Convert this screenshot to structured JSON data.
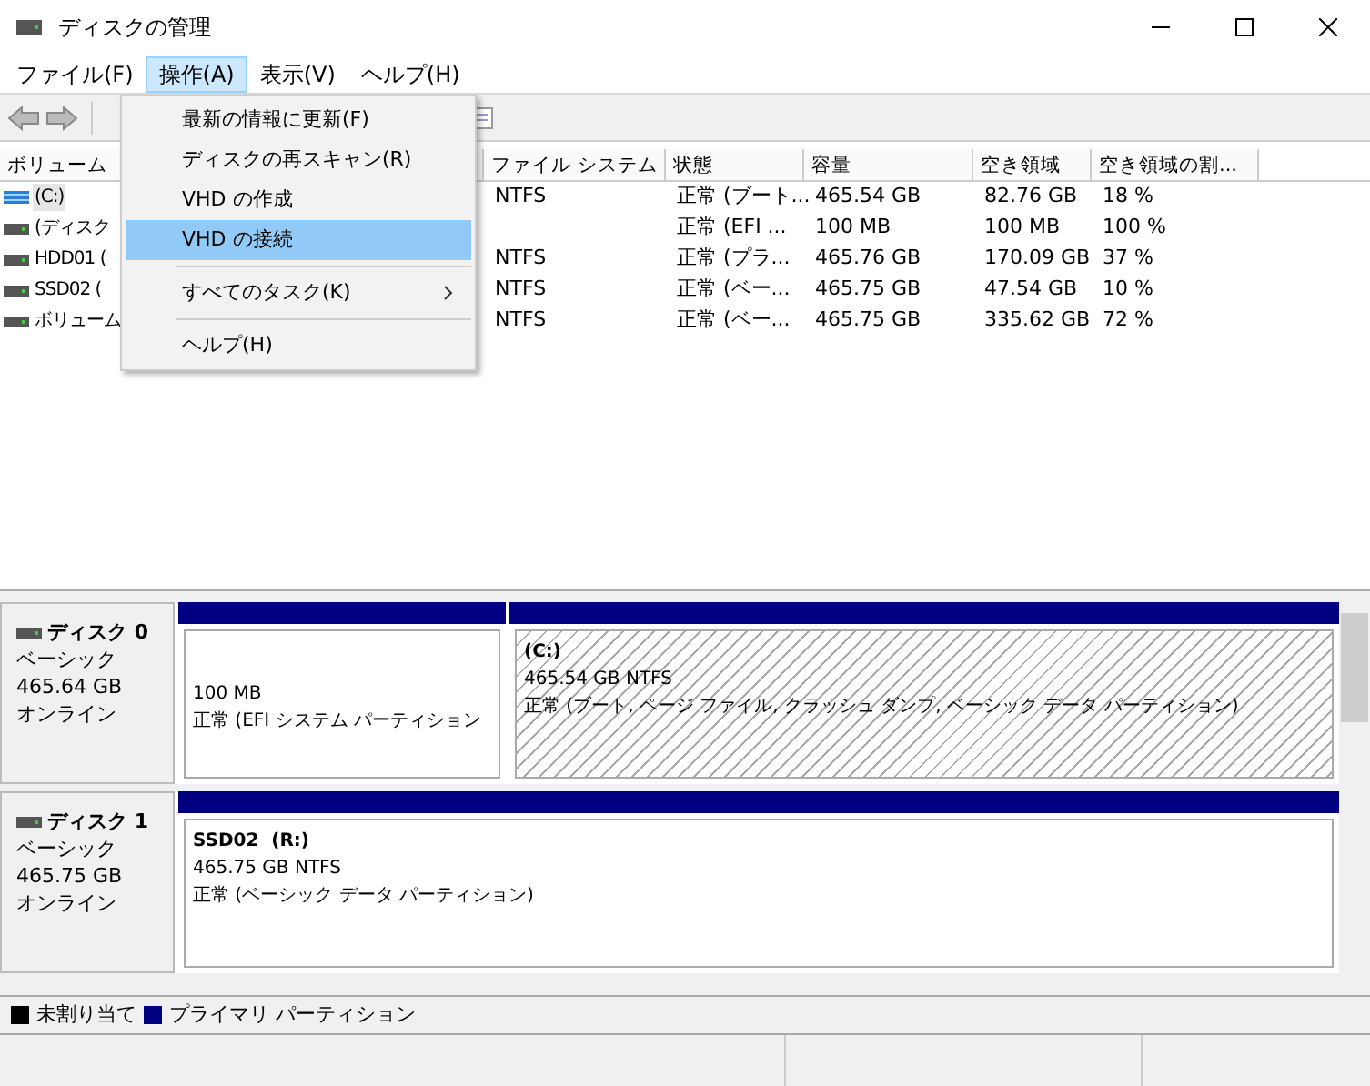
{
  "window": {
    "title": "ディスクの管理"
  },
  "menu_bar": [
    {
      "label": "ファイル(F)",
      "selected": false
    },
    {
      "label": "操作(A)",
      "selected": true
    },
    {
      "label": "表示(V)",
      "selected": false
    },
    {
      "label": "ヘルプ(H)",
      "selected": false
    }
  ],
  "dropdown": [
    {
      "label": "最新の情報に更新(F)",
      "selected": false,
      "submenu": false,
      "divider_after": false
    },
    {
      "label": "ディスクの再スキャン(R)",
      "selected": false,
      "submenu": false,
      "divider_after": false
    },
    {
      "label": "VHD の作成",
      "selected": false,
      "submenu": false,
      "divider_after": false
    },
    {
      "label": "VHD の接続",
      "selected": true,
      "submenu": false,
      "divider_after": true
    },
    {
      "label": "すべてのタスク(K)",
      "selected": false,
      "submenu": true,
      "divider_after": true
    },
    {
      "label": "ヘルプ(H)",
      "selected": false,
      "submenu": false,
      "divider_after": false
    }
  ],
  "table": {
    "columns": [
      "ボリューム",
      "ファイル システム",
      "状態",
      "容量",
      "空き領域",
      "空き領域の割..."
    ],
    "rows": [
      {
        "kind": "system",
        "selected": true,
        "cells": [
          "(C:)",
          "NTFS",
          "正常 (ブート...",
          "465.54 GB",
          "82.76 GB",
          "18 %"
        ]
      },
      {
        "kind": "disk",
        "selected": false,
        "cells": [
          "(ディスク",
          "",
          "正常 (EFI ...",
          "100 MB",
          "100 MB",
          "100 %"
        ]
      },
      {
        "kind": "disk",
        "selected": false,
        "cells": [
          "HDD01 (",
          "NTFS",
          "正常 (プラ...",
          "465.76 GB",
          "170.09 GB",
          "37 %"
        ]
      },
      {
        "kind": "disk",
        "selected": false,
        "cells": [
          "SSD02 (",
          "NTFS",
          "正常 (ベー...",
          "465.75 GB",
          "47.54 GB",
          "10 %"
        ]
      },
      {
        "kind": "disk",
        "selected": false,
        "cells": [
          "ボリューム",
          "NTFS",
          "正常 (ベー...",
          "465.75 GB",
          "335.62 GB",
          "72 %"
        ]
      }
    ]
  },
  "disks": [
    {
      "name": "ディスク 0",
      "type": "ベーシック",
      "size": "465.64 GB",
      "status": "オンライン",
      "partitions": [
        {
          "size": "100 MB",
          "status": "正常 (EFI システム パーティション",
          "selected": false
        },
        {
          "label": "(C:)",
          "size": "465.54 GB NTFS",
          "status": "正常 (ブート, ページ ファイル, クラッシュ ダンプ, ベーシック データ パーティション)",
          "selected": true
        }
      ]
    },
    {
      "name": "ディスク 1",
      "type": "ベーシック",
      "size": "465.75 GB",
      "status": "オンライン",
      "partitions": [
        {
          "label": "SSD02  (R:)",
          "size": "465.75 GB NTFS",
          "status": "正常 (ベーシック データ パーティション)",
          "selected": false
        }
      ]
    }
  ],
  "legend": [
    {
      "label": "未割り当て",
      "color": "#000000"
    },
    {
      "label": "プライマリ パーティション",
      "color": "#000080"
    }
  ]
}
